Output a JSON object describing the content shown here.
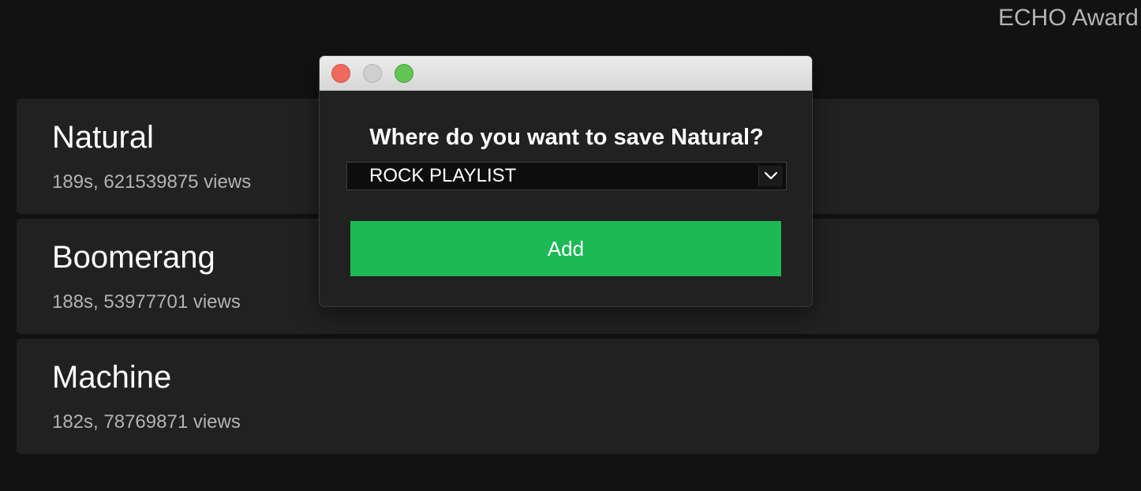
{
  "header": {
    "corner_label": "ECHO Award"
  },
  "songs": [
    {
      "title": "Natural",
      "meta": "189s, 621539875 views"
    },
    {
      "title": "Boomerang",
      "meta": "188s, 53977701 views"
    },
    {
      "title": "Machine",
      "meta": "182s, 78769871 views"
    }
  ],
  "dialog": {
    "question": "Where do you want to save Natural?",
    "playlist_select": {
      "selected": "ROCK PLAYLIST"
    },
    "add_label": "Add",
    "window_controls": {
      "close_color": "#ee6a5f",
      "minimize_color": "#cfcfcf",
      "zoom_color": "#61c554"
    }
  },
  "colors": {
    "background": "#121212",
    "card": "#212121",
    "accent": "#1db954"
  }
}
